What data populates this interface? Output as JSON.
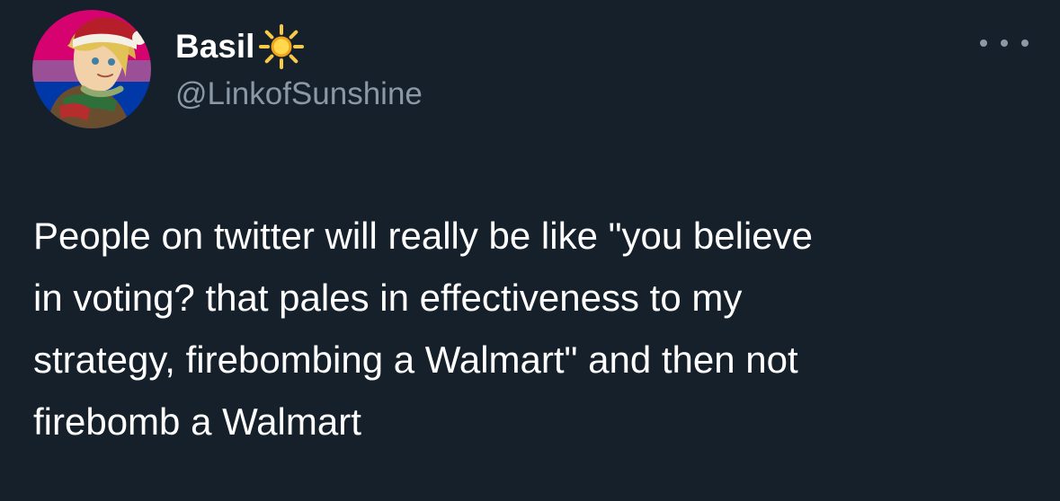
{
  "tweet": {
    "author": {
      "display_name": "Basil",
      "name_emoji_icon": "sun-icon",
      "handle": "@LinkofSunshine",
      "avatar_icon": "avatar-image"
    },
    "menu_icon": "more-options-icon",
    "text_lines": [
      "People on twitter will really be like \"you believe",
      "in voting? that pales in effectiveness to my",
      "strategy, firebombing a Walmart\" and then not",
      "firebomb a Walmart"
    ]
  },
  "colors": {
    "background": "#15202b",
    "primary_text": "#ffffff",
    "secondary_text": "#8b98a5",
    "sun": "#f7c948",
    "avatar_flag_pink": "#d60270",
    "avatar_flag_purple": "#9b4f96",
    "avatar_flag_blue": "#0038a8"
  }
}
